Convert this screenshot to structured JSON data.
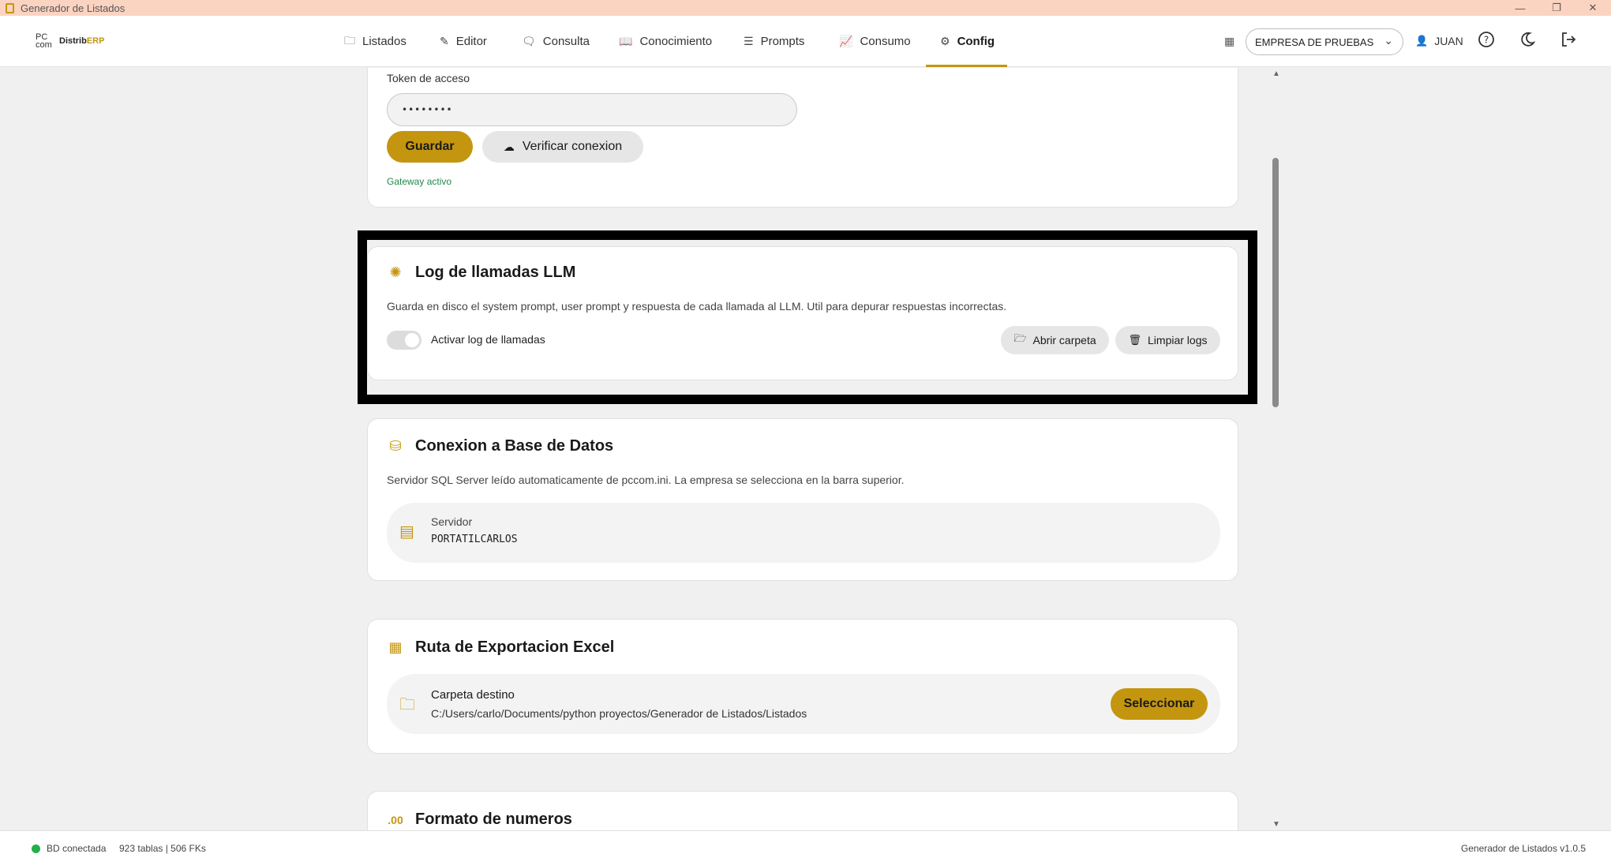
{
  "window": {
    "title": "Generador de Listados",
    "controls": [
      "—",
      "❐",
      "✕"
    ]
  },
  "logo": {
    "pc": "PC",
    "com": "com",
    "distrib": "Distrib",
    "erp": "ERP"
  },
  "nav": {
    "items": [
      {
        "label": "Listados",
        "icon": "folder-icon"
      },
      {
        "label": "Editor",
        "icon": "edit-icon"
      },
      {
        "label": "Consulta",
        "icon": "chat-icon"
      },
      {
        "label": "Conocimiento",
        "icon": "book-icon"
      },
      {
        "label": "Prompts",
        "icon": "sliders-icon"
      },
      {
        "label": "Consumo",
        "icon": "chart-icon"
      },
      {
        "label": "Config",
        "icon": "gear-icon",
        "active": true
      }
    ]
  },
  "header": {
    "company": "EMPRESA DE PRUEBAS",
    "user": "JUAN"
  },
  "gateway": {
    "token_label": "Token de acceso",
    "token_value": "••••••••",
    "save_label": "Guardar",
    "verify_label": "Verificar conexion",
    "status": "Gateway activo"
  },
  "llm_log": {
    "title": "Log de llamadas LLM",
    "description": "Guarda en disco el system prompt, user prompt y respuesta de cada llamada al LLM. Util para depurar respuestas incorrectas.",
    "toggle_label": "Activar log de llamadas",
    "toggle_on": false,
    "open_folder_label": "Abrir carpeta",
    "clear_logs_label": "Limpiar logs"
  },
  "database": {
    "title": "Conexion a Base de Datos",
    "description": "Servidor SQL Server leído automaticamente de pccom.ini. La empresa se selecciona en la barra superior.",
    "server_label": "Servidor",
    "server_value": "PORTATILCARLOS"
  },
  "excel": {
    "title": "Ruta de Exportacion Excel",
    "folder_label": "Carpeta destino",
    "folder_path": "C:/Users/carlo/Documents/python proyectos/Generador de Listados/Listados",
    "select_label": "Seleccionar"
  },
  "numbers": {
    "title": "Formato de numeros"
  },
  "footer": {
    "db_status": "BD conectada",
    "tables_info": "923 tablas | 506 FKs",
    "version": "Generador de Listados v1.0.5"
  },
  "colors": {
    "accent": "#c4960f",
    "status_green": "#22b04a",
    "titlebar": "#fbd3c1"
  }
}
